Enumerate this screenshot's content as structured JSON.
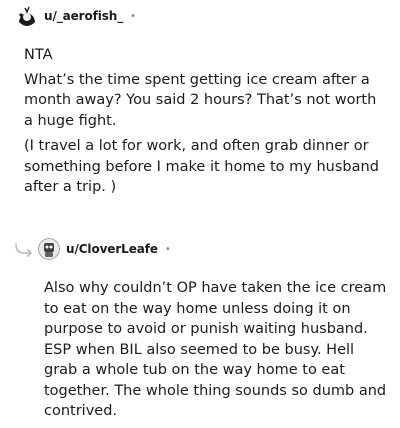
{
  "comments": [
    {
      "username": "u/_aerofish_",
      "separator": "•",
      "paragraphs": [
        "NTA",
        "What’s the time spent getting ice cream after a month away? You said 2 hours? That’s not worth a huge fight.",
        "(I travel a lot for work, and often grab dinner or something before I make it home to my husband after a trip. )"
      ]
    },
    {
      "username": "u/CloverLeafe",
      "separator": "•",
      "paragraphs": [
        "Also why couldn’t OP have taken the ice cream to eat on the way home unless doing it on purpose to avoid or punish waiting husband. ESP when BIL also seemed to be busy. Hell grab a whole tub on the way home to eat together. The whole thing sounds so dumb and contrived."
      ]
    }
  ],
  "colors": {
    "text": "#1c1c1c",
    "muted": "#878a8c"
  }
}
